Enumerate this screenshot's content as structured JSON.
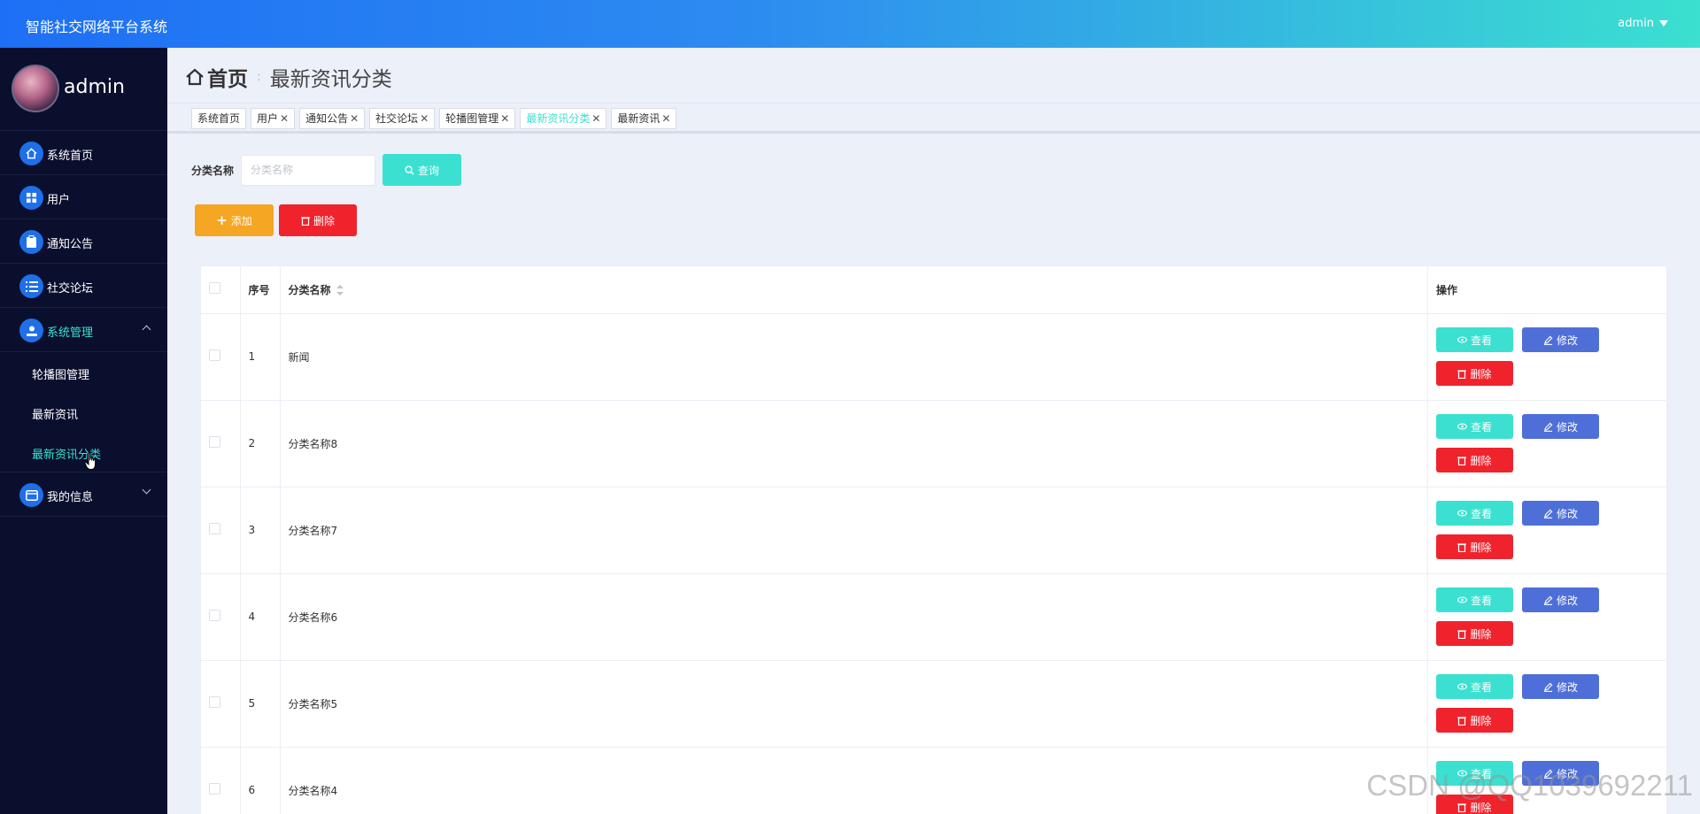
{
  "topbar": {
    "title": "智能社交网络平台系统",
    "user": "admin"
  },
  "sidebar": {
    "username": "admin",
    "items": [
      {
        "label": "系统首页",
        "icon": "home-icon"
      },
      {
        "label": "用户",
        "icon": "grid-icon"
      },
      {
        "label": "通知公告",
        "icon": "clipboard-icon"
      },
      {
        "label": "社交论坛",
        "icon": "list-icon"
      },
      {
        "label": "系统管理",
        "icon": "user-settings-icon"
      },
      {
        "label": "我的信息",
        "icon": "card-icon"
      }
    ],
    "subitems": [
      {
        "label": "轮播图管理"
      },
      {
        "label": "最新资讯"
      },
      {
        "label": "最新资讯分类"
      }
    ]
  },
  "breadcrumb": {
    "home": "首页",
    "current": "最新资讯分类"
  },
  "tabs": [
    {
      "label": "系统首页",
      "closable": false
    },
    {
      "label": "用户",
      "closable": true
    },
    {
      "label": "通知公告",
      "closable": true
    },
    {
      "label": "社交论坛",
      "closable": true
    },
    {
      "label": "轮播图管理",
      "closable": true
    },
    {
      "label": "最新资讯分类",
      "closable": true,
      "active": true
    },
    {
      "label": "最新资讯",
      "closable": true
    }
  ],
  "search": {
    "label": "分类名称",
    "placeholder": "分类名称",
    "button": "查询"
  },
  "actions": {
    "add": "添加",
    "delete": "删除"
  },
  "table": {
    "headers": {
      "index": "序号",
      "name": "分类名称",
      "ops": "操作"
    },
    "rows": [
      {
        "index": "1",
        "name": "新闻"
      },
      {
        "index": "2",
        "name": "分类名称8"
      },
      {
        "index": "3",
        "name": "分类名称7"
      },
      {
        "index": "4",
        "name": "分类名称6"
      },
      {
        "index": "5",
        "name": "分类名称5"
      },
      {
        "index": "6",
        "name": "分类名称4"
      }
    ],
    "row_buttons": {
      "view": "查看",
      "edit": "修改",
      "delete": "删除"
    }
  },
  "watermark": "CSDN @QQ1039692211",
  "colors": {
    "accent": "#3be0d0",
    "primary": "#1f6fe8",
    "danger": "#f0232d",
    "warning": "#f5a623",
    "edit": "#4f6fd8",
    "sidebar": "#0b0f2e"
  }
}
